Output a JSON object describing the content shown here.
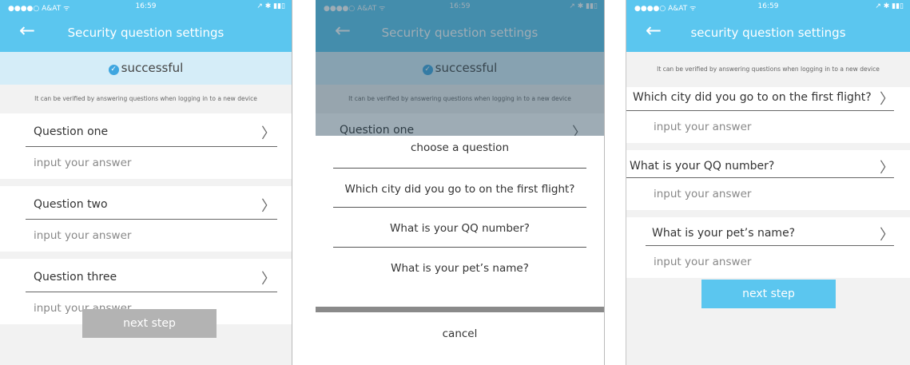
{
  "status": {
    "carrier": "●●●●○ A&AT ᯤ",
    "time": "16:59",
    "right": "↗ ✱ ▮▮▯"
  },
  "screen1": {
    "title": "Security question settings",
    "banner": "successful",
    "hint": "It can be verified by answering questions when logging in to a new device",
    "questions": [
      "Question one",
      "Question two",
      "Question three"
    ],
    "answer_placeholder": "input your answer",
    "next": "next step",
    "next_color": "#b3b3b3"
  },
  "screen2": {
    "title": "Security question settings",
    "banner": "successful",
    "hint": "It can be verified by answering questions when logging in to a new device",
    "peek_question": "Question one",
    "sheet_title": "choose a question",
    "options": [
      "Which city did you go to on the first flight?",
      "What is your QQ number?",
      "What is your pet’s name?"
    ],
    "cancel": "cancel"
  },
  "screen3": {
    "title": "security question settings",
    "hint": "It can be verified by answering questions when logging in to a new device",
    "questions": [
      "Which city did you go to on the first flight?",
      "What is your QQ number?",
      "What is your pet’s name?"
    ],
    "answer_placeholder": "input your answer",
    "next": "next step",
    "next_color": "#5bc6ef"
  },
  "colors": {
    "accent": "#5bc6ef",
    "banner_bg": "#d5edf8",
    "check": "#3fa6e0"
  }
}
